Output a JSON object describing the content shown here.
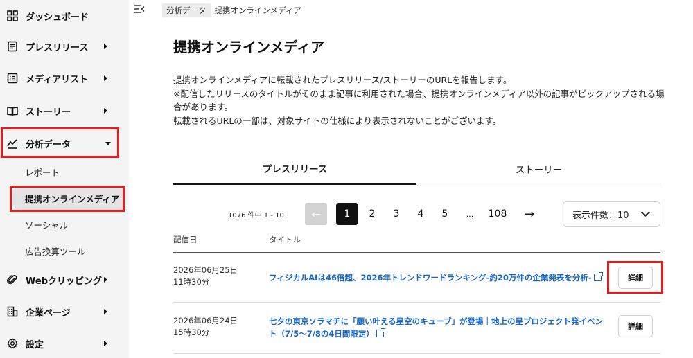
{
  "sidebar": {
    "items": [
      {
        "label": "ダッシュボード"
      },
      {
        "label": "プレスリリース"
      },
      {
        "label": "メディアリスト"
      },
      {
        "label": "ストーリー"
      },
      {
        "label": "分析データ"
      },
      {
        "label": "Webクリッピング"
      },
      {
        "label": "企業ページ"
      },
      {
        "label": "設定"
      }
    ],
    "sub_items": [
      {
        "label": "レポート"
      },
      {
        "label": "提携オンラインメディア"
      },
      {
        "label": "ソーシャル"
      },
      {
        "label": "広告換算ツール"
      }
    ]
  },
  "breadcrumb": {
    "parent": "分析データ",
    "current": "提携オンラインメディア"
  },
  "page": {
    "title": "提携オンラインメディア",
    "description": [
      "提携オンラインメディアに転載されたプレスリリース/ストーリーのURLを報告します。",
      "※配信したリリースのタイトルがそのまま記事に利用された場合、提携オンラインメディア以外の記事がピックアップされる場合があります。",
      "転載されるURLの一部は、対象サイトの仕様により表示されないことがございます。"
    ]
  },
  "tabs": [
    {
      "label": "プレスリリース"
    },
    {
      "label": "ストーリー"
    }
  ],
  "pagination": {
    "count_text": "1076 件中 1 - 10",
    "prev": "←",
    "pages": [
      "1",
      "2",
      "3",
      "4",
      "5",
      "...",
      "108"
    ],
    "next": "→"
  },
  "per_page": {
    "label": "表示件数：10"
  },
  "table": {
    "headers": {
      "date": "配信日",
      "title": "タイトル"
    },
    "rows": [
      {
        "date": "2026年06月25日",
        "time": "11時30分",
        "title": "フィジカルAIは46倍超、2026年トレンドワードランキング-約20万件の企業発表を分析-",
        "detail": "詳細"
      },
      {
        "date": "2026年06月24日",
        "time": "15時30分",
        "title": "七夕の東京ソラマチに「願い叶える星空のキューブ」が登場｜地上の星プロジェクト発イベント（7/5〜7/8の4日間限定）",
        "detail": "詳細"
      }
    ]
  },
  "colors": {
    "highlight": "#e02020",
    "link": "#1565c8",
    "sidebar_bg": "#f4f4f4"
  }
}
